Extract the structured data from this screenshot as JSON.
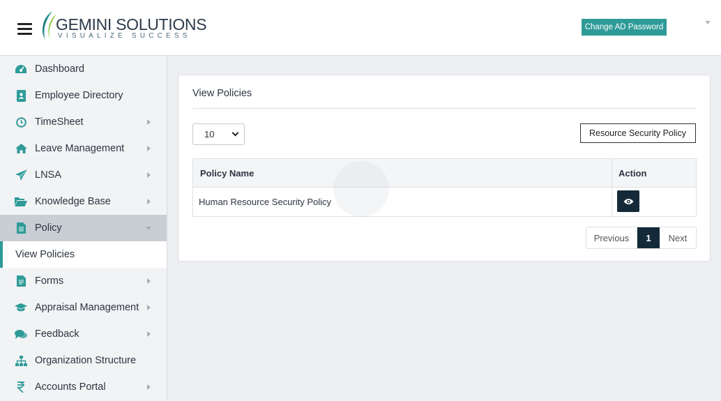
{
  "header": {
    "logo_title": "GEMINI SOLUTIONS",
    "logo_tagline": "VISUALIZE SUCCESS",
    "change_password_label": "Change AD Password"
  },
  "sidebar": {
    "items": [
      {
        "label": "Dashboard",
        "icon": "dashboard-icon",
        "submenu": false
      },
      {
        "label": "Employee Directory",
        "icon": "contact-book-icon",
        "submenu": false
      },
      {
        "label": "TimeSheet",
        "icon": "clock-icon",
        "submenu": true
      },
      {
        "label": "Leave Management",
        "icon": "home-icon",
        "submenu": true
      },
      {
        "label": "LNSA",
        "icon": "paper-plane-icon",
        "submenu": true
      },
      {
        "label": "Knowledge Base",
        "icon": "folder-open-icon",
        "submenu": true
      },
      {
        "label": "Policy",
        "icon": "document-icon",
        "submenu": true,
        "active": true
      },
      {
        "label": "Forms",
        "icon": "form-icon",
        "submenu": true
      },
      {
        "label": "Appraisal Management",
        "icon": "graduation-cap-icon",
        "submenu": true
      },
      {
        "label": "Feedback",
        "icon": "chat-icon",
        "submenu": true
      },
      {
        "label": "Organization Structure",
        "icon": "sitemap-icon",
        "submenu": false
      },
      {
        "label": "Accounts Portal",
        "icon": "rupee-icon",
        "submenu": true
      }
    ],
    "subitem": "View Policies"
  },
  "main": {
    "title": "View Policies",
    "page_length": "10",
    "search_value": "Resource Security Policy",
    "table": {
      "columns": [
        "Policy Name",
        "Action"
      ],
      "rows": [
        {
          "policy_name": "Human Resource Security Policy",
          "action_icon": "eye-icon"
        }
      ]
    },
    "pagination": {
      "previous": "Previous",
      "current": "1",
      "next": "Next"
    }
  },
  "colors": {
    "accent": "#2e9b98",
    "dark": "#142a38",
    "sidebar_bg": "#f2f3f5",
    "active_bg": "#c9ced4"
  }
}
